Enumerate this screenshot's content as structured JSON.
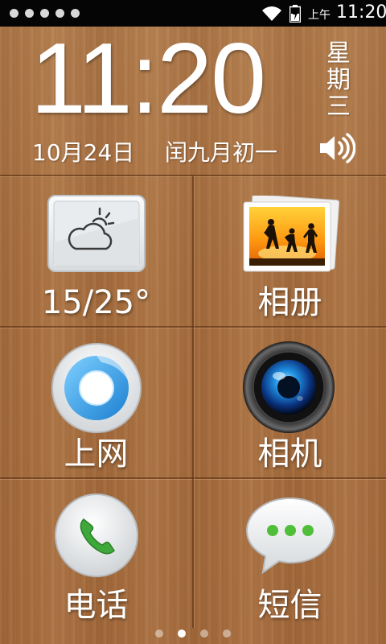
{
  "status_bar": {
    "ampm": "上午",
    "time": "11:20",
    "notification_count": 5
  },
  "clock": {
    "time": "11:20",
    "weekday": "星期三",
    "date": "10月24日",
    "lunar_date": "闰九月初一"
  },
  "tiles": {
    "weather": {
      "label": "15/25°",
      "icon": "partly-cloudy-icon"
    },
    "gallery": {
      "label": "相册",
      "icon": "photo-gallery-icon"
    },
    "browser": {
      "label": "上网",
      "icon": "browser-icon"
    },
    "camera": {
      "label": "相机",
      "icon": "camera-lens-icon"
    },
    "phone": {
      "label": "电话",
      "icon": "phone-icon"
    },
    "messages": {
      "label": "短信",
      "icon": "message-bubble-icon"
    }
  },
  "pager": {
    "pages": 4,
    "active_index": 1
  },
  "colors": {
    "wood": "#a86f3f",
    "statusbar": "#050505",
    "phone_green": "#3fa83a",
    "sms_green": "#4fbf3a",
    "browser_blue": "#2a9fe0"
  }
}
